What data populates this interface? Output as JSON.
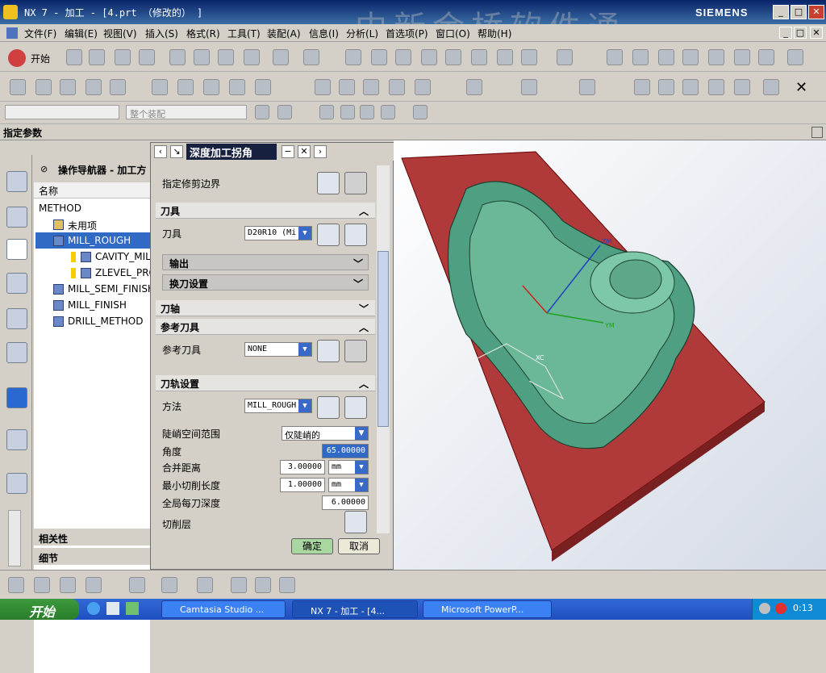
{
  "window": {
    "title": "NX 7 - 加工 - [4.prt （修改的） ]",
    "brand": "SIEMENS",
    "watermark": "中新金桥软件通"
  },
  "menu": [
    "文件(F)",
    "编辑(E)",
    "视图(V)",
    "插入(S)",
    "格式(R)",
    "工具(T)",
    "装配(A)",
    "信息(I)",
    "分析(L)",
    "首选项(P)",
    "窗口(O)",
    "帮助(H)"
  ],
  "toolbar": {
    "start_label": "开始",
    "filter_assembly": "整个装配"
  },
  "statusline": {
    "prompt": "指定参数"
  },
  "navigator": {
    "title": "操作导航器 - 加工方",
    "column_name": "名称",
    "items": [
      {
        "label": "METHOD"
      },
      {
        "label": "未用项"
      },
      {
        "label": "MILL_ROUGH"
      },
      {
        "label": "CAVITY_MIL"
      },
      {
        "label": "ZLEVEL_PRO"
      },
      {
        "label": "MILL_SEMI_FINISH"
      },
      {
        "label": "MILL_FINISH"
      },
      {
        "label": "DRILL_METHOD"
      }
    ],
    "section_dependency": "相关性",
    "section_details": "细节"
  },
  "dialog": {
    "title": "深度加工拐角",
    "trim_boundary_label": "指定修剪边界",
    "tool_section": "刀具",
    "tool_label": "刀具",
    "tool_value": "D20R10 (Mi",
    "output_label": "输出",
    "tool_change_label": "换刀设置",
    "axis_section": "刀轴",
    "ref_tool_section": "参考刀具",
    "ref_tool_label": "参考刀具",
    "ref_tool_value": "NONE",
    "path_section": "刀轨设置",
    "method_label": "方法",
    "method_value": "MILL_ROUGH",
    "steep_label": "陡峭空间范围",
    "steep_value": "仅陡峭的",
    "angle_label": "角度",
    "angle_value": "65.00000",
    "merge_label": "合并距离",
    "merge_value": "3.00000",
    "merge_unit": "mm",
    "min_cut_label": "最小切削长度",
    "min_cut_value": "1.00000",
    "min_cut_unit": "mm",
    "depth_label": "全局每刀深度",
    "depth_value": "6.00000",
    "cut_levels_label": "切削层",
    "ok_label": "确定",
    "cancel_label": "取消"
  },
  "viewport": {
    "axes": [
      "ZM",
      "YM",
      "XC"
    ],
    "plate_color": "#b03a3a",
    "part_color": "#4fa082"
  },
  "taskbar": {
    "start_label": "开始",
    "items": [
      {
        "label": "Camtasia Studio ..."
      },
      {
        "label": "NX 7 - 加工 - [4..."
      },
      {
        "label": "Microsoft PowerP..."
      }
    ],
    "clock": "0:13"
  }
}
